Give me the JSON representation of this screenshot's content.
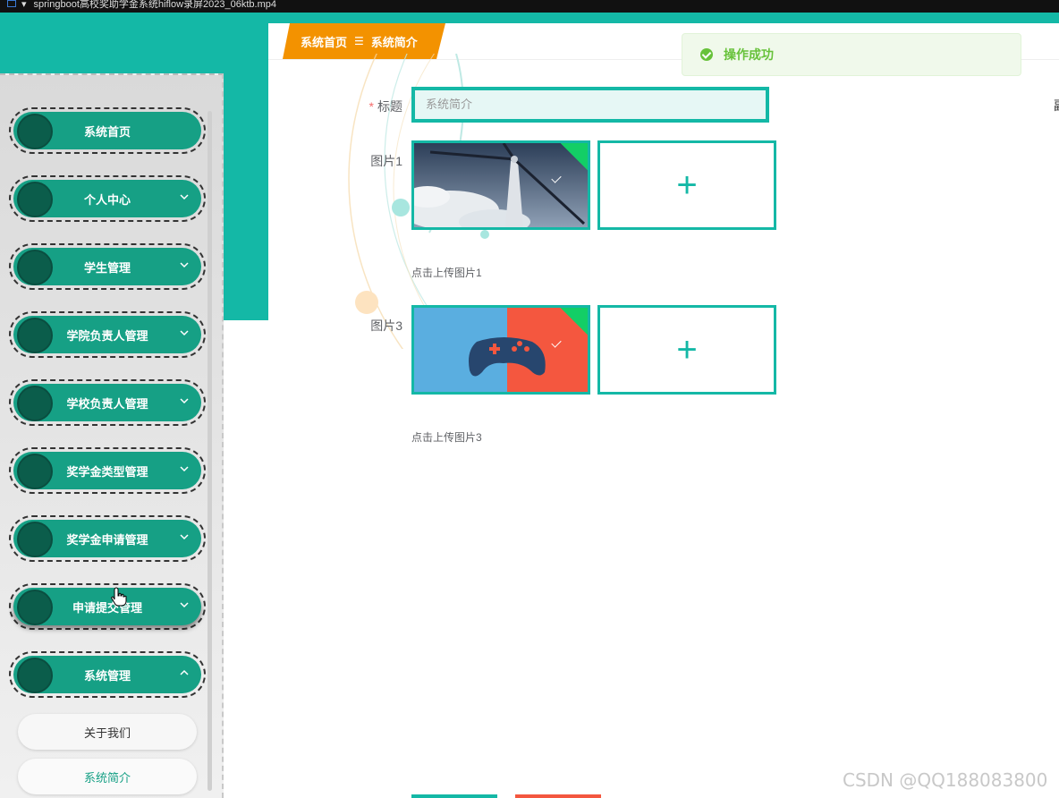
{
  "window": {
    "title": "springboot高校奖助学金系统hiflow录屏2023_06ktb.mp4"
  },
  "colors": {
    "accent": "#14b8a6",
    "menu": "#16a085",
    "breadcrumb": "#f39200",
    "success": "#67c23a"
  },
  "breadcrumb": {
    "home": "系统首页",
    "separator": "☰",
    "current": "系统简介"
  },
  "toast": {
    "message": "操作成功"
  },
  "sidebar": {
    "items": [
      {
        "label": "系统首页",
        "chevron": ""
      },
      {
        "label": "个人中心",
        "chevron": "down"
      },
      {
        "label": "学生管理",
        "chevron": "down"
      },
      {
        "label": "学院负责人管理",
        "chevron": "down"
      },
      {
        "label": "学校负责人管理",
        "chevron": "down"
      },
      {
        "label": "奖学金类型管理",
        "chevron": "down"
      },
      {
        "label": "奖学金申请管理",
        "chevron": "down"
      },
      {
        "label": "申请提交管理",
        "chevron": "down"
      },
      {
        "label": "系统管理",
        "chevron": "up"
      }
    ],
    "subitems": [
      {
        "label": "关于我们"
      },
      {
        "label": "系统简介"
      }
    ]
  },
  "form": {
    "title_label": "标题",
    "title_value": "系统简介",
    "image1_label": "图片1",
    "image1_hint": "点击上传图片1",
    "image3_label": "图片3",
    "image3_hint": "点击上传图片3",
    "upload_symbol": "+"
  },
  "right_edge_text": "副",
  "watermark": "CSDN @QQ188083800"
}
